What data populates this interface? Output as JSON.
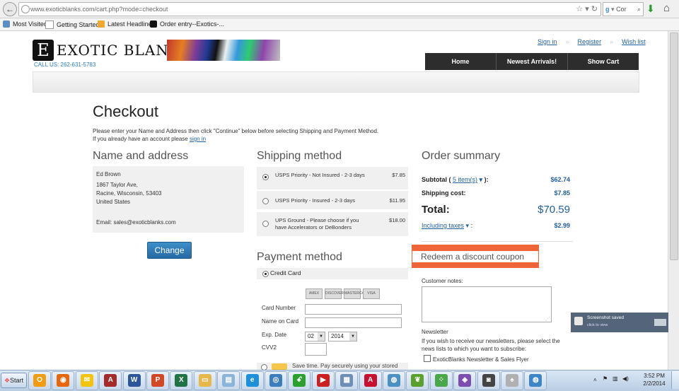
{
  "browser": {
    "url": "www.exoticblanks.com/cart.php?mode=checkout",
    "search_placeholder": "Cor",
    "bookmarks": [
      "Most Visited",
      "Getting Started",
      "Latest Headlines",
      "Order entry--Exotics-..."
    ]
  },
  "header": {
    "links": [
      "Sign in",
      "Register",
      "Wish list"
    ],
    "logo_initial": "E",
    "logo_text": "EXOTIC BLANKS",
    "call_us": "CALL US: 262-631-5783",
    "nav": [
      "Home",
      "Newest Arrivals!",
      "Show Cart"
    ]
  },
  "checkout": {
    "title": "Checkout",
    "intro_line1": "Please enter your Name and Address then click \"Continue\" below before selecting Shipping and Payment Method.",
    "intro_line2_prefix": "If you already have an account please",
    "intro_line2_link": "sign in",
    "name_address": {
      "heading": "Name and address",
      "name": "Ed Brown",
      "street": "1867 Taylor Ave,",
      "city": "Racine, Wisconsin, 53403",
      "country": "United States",
      "email": "Email: sales@exoticblanks.com",
      "change_label": "Change"
    },
    "shipping": {
      "heading": "Shipping method",
      "options": [
        {
          "label": "USPS Priority - Not Insured - 2-3 days",
          "price": "$7.85",
          "selected": true
        },
        {
          "label": "USPS Priority - Insured - 2-3 days",
          "price": "$11.95",
          "selected": false
        },
        {
          "label": "UPS Ground - Please choose if you have Accelerators or DeBonders",
          "price": "$18.00",
          "selected": false
        }
      ]
    },
    "payment": {
      "heading": "Payment method",
      "credit_card_label": "Credit Card",
      "cards": [
        "AMEX",
        "DISCOVER",
        "MASTERCARD",
        "VISA"
      ],
      "fields": [
        "Card Number",
        "Name on Card",
        "Exp. Date",
        "CVV2"
      ],
      "exp_month": "02",
      "exp_year": "2014",
      "partial_text": "Save time. Pay securely using your stored"
    },
    "summary": {
      "heading": "Order summary",
      "subtotal_label": "Subtotal (",
      "items_link": "5 item(s)",
      "subtotal_suffix": "):",
      "subtotal": "$62.74",
      "shipping_label": "Shipping cost:",
      "shipping": "$7.85",
      "total_label": "Total:",
      "total": "$70.59",
      "taxes_label": "Including taxes",
      "taxes": "$2.99",
      "coupon_label": "Redeem a discount coupon",
      "notes_label": "Customer notes:",
      "newsletter_heading": "Newsletter",
      "newsletter_text": "If you wish to receive our newsletters, please select the news lists to which you want to subscribe:",
      "newsletter_option": "ExoticBlanks Newsletter & Sales Flyer"
    }
  },
  "toast": {
    "title": "Screenshot saved",
    "subtitle": "click to view"
  },
  "taskbar": {
    "start": "Start",
    "time": "3:52 PM",
    "date": "2/2/2014",
    "apps": [
      {
        "name": "outlook",
        "color": "#f39c12",
        "glyph": "O"
      },
      {
        "name": "firefox",
        "color": "#e8660c",
        "glyph": "◉"
      },
      {
        "name": "mail",
        "color": "#f1c40f",
        "glyph": "✉"
      },
      {
        "name": "access",
        "color": "#a52a2a",
        "glyph": "A"
      },
      {
        "name": "word",
        "color": "#2b579a",
        "glyph": "W"
      },
      {
        "name": "powerpoint",
        "color": "#d24726",
        "glyph": "P"
      },
      {
        "name": "excel",
        "color": "#217346",
        "glyph": "X"
      },
      {
        "name": "folder",
        "color": "#e6b84c",
        "glyph": "▭"
      },
      {
        "name": "explorer",
        "color": "#8ab4d8",
        "glyph": "▤"
      },
      {
        "name": "internet-explorer",
        "color": "#1e90d8",
        "glyph": "e"
      },
      {
        "name": "network",
        "color": "#3b7dbf",
        "glyph": "◎"
      },
      {
        "name": "nero",
        "color": "#2ca02c",
        "glyph": "ꗃ"
      },
      {
        "name": "youtube",
        "color": "#cc1f1f",
        "glyph": "▶"
      },
      {
        "name": "calculator",
        "color": "#6d8fb5",
        "glyph": "▦"
      },
      {
        "name": "acrobat",
        "color": "#c8102e",
        "glyph": "A"
      },
      {
        "name": "globe",
        "color": "#4a90c2",
        "glyph": "◍"
      },
      {
        "name": "feather",
        "color": "#5aa02c",
        "glyph": "❦"
      },
      {
        "name": "dice",
        "color": "#49a84a",
        "glyph": "⁘"
      },
      {
        "name": "picasa",
        "color": "#7b4fb0",
        "glyph": "◈"
      },
      {
        "name": "camera",
        "color": "#444444",
        "glyph": "◙"
      },
      {
        "name": "cards",
        "color": "#b0b0b0",
        "glyph": "♠"
      },
      {
        "name": "globe2",
        "color": "#3d85c6",
        "glyph": "◍"
      }
    ]
  }
}
